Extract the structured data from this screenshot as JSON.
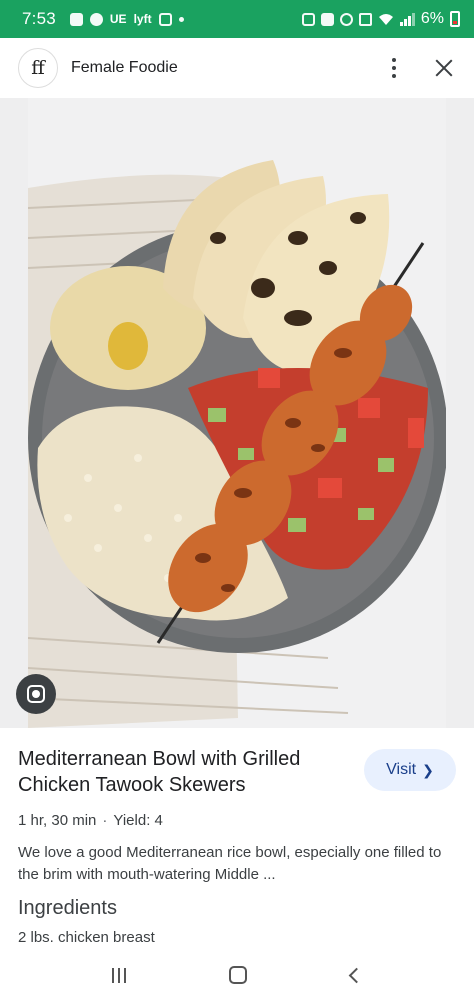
{
  "status_bar": {
    "time": "7:53",
    "left_icons": [
      "lock-icon",
      "messenger-icon",
      "ue-icon",
      "lyft-icon",
      "instagram-icon",
      "dot-icon"
    ],
    "ue_text": "UE",
    "lyft_text": "lyft",
    "right_icons": [
      "nfc-icon",
      "n-icon",
      "alarm-icon",
      "mute-icon",
      "wifi-icon",
      "signal-icon"
    ],
    "battery_pct": "6%"
  },
  "header": {
    "logo_text": "ff",
    "site_name": "Female Foodie",
    "more_icon": "more-vert-icon",
    "close_icon": "close-icon"
  },
  "image": {
    "description_icon": "google-lens-icon",
    "colors": {
      "bowl": "#6b6e70",
      "towel": "#d8d1c6",
      "chicken": "#cc6a2e",
      "rice": "#ece2c8",
      "hummus": "#e9d9a8",
      "pita": "#ead8ae",
      "tomato": "#d6352a",
      "cucumber": "#9bc26b"
    }
  },
  "result": {
    "title": "Mediterranean Bowl with Grilled Chicken Tawook Skewers",
    "visit_label": "Visit",
    "visit_icon": "chevron-right-icon",
    "time": "1 hr, 30 min",
    "separator": "·",
    "yield": "Yield: 4",
    "description": "We love a good Mediterranean rice bowl, especially one filled to the brim with mouth-watering Middle ...",
    "ingredients_heading": "Ingredients",
    "ingredients": [
      "2 lbs. chicken breast"
    ]
  },
  "nav_bar": {
    "recents_icon": "recents-icon",
    "home_icon": "home-icon",
    "back_icon": "back-icon"
  }
}
